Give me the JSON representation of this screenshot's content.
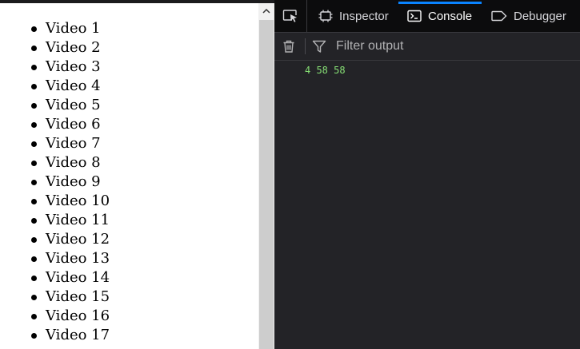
{
  "page": {
    "items": [
      "Video 1",
      "Video 2",
      "Video 3",
      "Video 4",
      "Video 5",
      "Video 6",
      "Video 7",
      "Video 8",
      "Video 9",
      "Video 10",
      "Video 11",
      "Video 12",
      "Video 13",
      "Video 14",
      "Video 15",
      "Video 16",
      "Video 17"
    ]
  },
  "devtools": {
    "tabs": {
      "inspector": "Inspector",
      "console": "Console",
      "debugger": "Debugger"
    },
    "active_tab": "Console",
    "filter_placeholder": "Filter output",
    "log_line": "4 58 58"
  },
  "icons": {
    "picker": "element-picker-icon",
    "inspector": "inspector-icon",
    "console": "console-icon",
    "debugger": "debugger-icon",
    "trash": "trash-icon",
    "filter": "filter-icon"
  },
  "colors": {
    "devtools_bg": "#232327",
    "tab_highlight": "#0a84ff",
    "log_text": "#86de74"
  }
}
